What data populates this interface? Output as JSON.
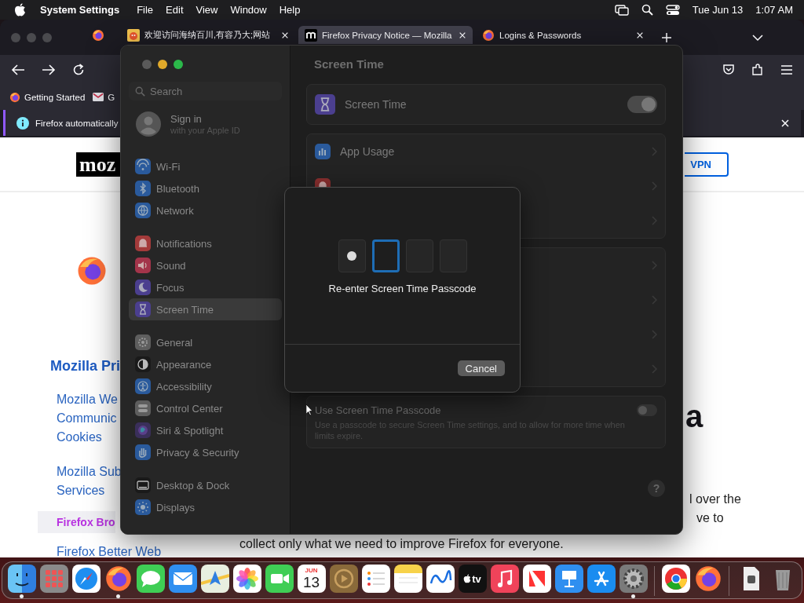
{
  "menubar": {
    "app_name": "System Settings",
    "menus": [
      "File",
      "Edit",
      "View",
      "Window",
      "Help"
    ],
    "date": "Tue Jun 13",
    "time": "1:07 AM"
  },
  "browser": {
    "tabs": [
      {
        "kind": "pinned",
        "selected": false
      },
      {
        "kind": "cartoon",
        "title": "欢迎访问海纳百川,有容乃大;网站",
        "selected": false
      },
      {
        "kind": "tile",
        "title": "Firefox Privacy Notice — Mozilla",
        "selected": true
      },
      {
        "kind": "fox",
        "title": "Logins & Passwords",
        "selected": false
      }
    ],
    "bookmarks": [
      {
        "label": "Getting Started",
        "kind": "fox"
      },
      {
        "label": "G",
        "kind": "envelope"
      }
    ],
    "notification": "Firefox automatically",
    "page": {
      "logo_text": "moz",
      "vpn_button": "VPN",
      "nav_heading": "Mozilla Pri",
      "nav_items": [
        {
          "lines": [
            "Mozilla We",
            "Communic",
            "Cookies"
          ],
          "selected": false
        },
        {
          "lines": [
            "Mozilla Sub",
            "Services"
          ],
          "selected": false
        },
        {
          "lines": [
            "Firefox Bro"
          ],
          "selected": true
        },
        {
          "lines": [
            "Firefox Better Web"
          ],
          "selected": false
        }
      ],
      "heading_fragment": "a",
      "body_lines": [
        "l over the",
        "ve to",
        "collect only what we need to improve Firefox for everyone."
      ]
    }
  },
  "settings": {
    "search": {
      "placeholder": "Search"
    },
    "account": {
      "title": "Sign in",
      "subtitle": "with your Apple ID"
    },
    "sidebar_groups": [
      {
        "items": [
          {
            "label": "Wi-Fi",
            "kind": "wifi",
            "color": "#2a5a9c",
            "selected": false
          },
          {
            "label": "Bluetooth",
            "kind": "bluetooth",
            "color": "#2a5a9c",
            "selected": false
          },
          {
            "label": "Network",
            "kind": "globe",
            "color": "#2a5a9c",
            "selected": false
          }
        ]
      },
      {
        "items": [
          {
            "label": "Notifications",
            "kind": "bell",
            "color": "#a33a3a",
            "selected": false
          },
          {
            "label": "Sound",
            "kind": "speaker",
            "color": "#a3344a",
            "selected": false
          },
          {
            "label": "Focus",
            "kind": "moon",
            "color": "#4b3f8f",
            "selected": false
          },
          {
            "label": "Screen Time",
            "kind": "hourglass",
            "color": "#4b3f8f",
            "selected": true
          }
        ]
      },
      {
        "items": [
          {
            "label": "General",
            "kind": "gear",
            "color": "#5e5e5e",
            "selected": false
          },
          {
            "label": "Appearance",
            "kind": "contrast",
            "color": "#1a1a1a",
            "selected": false
          },
          {
            "label": "Accessibility",
            "kind": "person",
            "color": "#2a5a9c",
            "selected": false
          },
          {
            "label": "Control Center",
            "kind": "toggles",
            "color": "#5e5e5e",
            "selected": false
          },
          {
            "label": "Siri & Spotlight",
            "kind": "orb",
            "color": "#3a2f5a",
            "selected": false
          },
          {
            "label": "Privacy & Security",
            "kind": "hand",
            "color": "#2a5a9c",
            "selected": false
          }
        ]
      },
      {
        "items": [
          {
            "label": "Desktop & Dock",
            "kind": "dock",
            "color": "#1a1a1a",
            "selected": false
          },
          {
            "label": "Displays",
            "kind": "sun",
            "color": "#2a5a9c",
            "selected": false
          }
        ]
      }
    ],
    "title": "Screen Time",
    "main_toggle": {
      "label": "Screen Time",
      "on": true
    },
    "usage_rows": [
      {
        "kind": "chart",
        "label": "App Usage"
      },
      {
        "kind": "bell"
      },
      {
        "kind": "hidden"
      }
    ],
    "limit_rows": [
      {
        "kind": "hidden"
      },
      {
        "kind": "hidden"
      },
      {
        "kind": "hidden"
      },
      {
        "kind": "hidden"
      }
    ],
    "passcode_setting": {
      "label": "Use Screen Time Passcode",
      "description": "Use a passcode to secure Screen Time settings, and to allow for more time when limits expire.",
      "on": false
    },
    "help_button": "?",
    "sheet": {
      "digits": [
        {
          "filled": true,
          "focused": false
        },
        {
          "filled": false,
          "focused": true
        },
        {
          "filled": false,
          "focused": false
        },
        {
          "filled": false,
          "focused": false
        }
      ],
      "prompt": "Re-enter Screen Time Passcode",
      "cancel": "Cancel"
    }
  },
  "dock": {
    "items": [
      {
        "kind": "finder",
        "running": true
      },
      {
        "kind": "launchpad",
        "running": false
      },
      {
        "kind": "safari",
        "running": false
      },
      {
        "kind": "firefox",
        "running": true
      },
      {
        "kind": "messages",
        "running": false
      },
      {
        "kind": "mail",
        "running": false
      },
      {
        "kind": "maps",
        "running": false
      },
      {
        "kind": "photos",
        "running": false
      },
      {
        "kind": "facetime",
        "running": false
      },
      {
        "kind": "calendar",
        "month": "JUN",
        "day": "13",
        "running": false
      },
      {
        "kind": "player",
        "running": false
      },
      {
        "kind": "reminders",
        "running": false
      },
      {
        "kind": "notes",
        "running": false
      },
      {
        "kind": "freeform",
        "running": false
      },
      {
        "kind": "tv",
        "text": "tv",
        "running": false
      },
      {
        "kind": "music",
        "running": false
      },
      {
        "kind": "news",
        "running": false
      },
      {
        "kind": "keynote",
        "running": false
      },
      {
        "kind": "store",
        "running": false
      },
      {
        "kind": "settings",
        "running": true
      },
      {
        "kind": "separator"
      },
      {
        "kind": "chrome",
        "running": false
      },
      {
        "kind": "firefox",
        "running": false
      },
      {
        "kind": "separator"
      },
      {
        "kind": "document",
        "running": false
      },
      {
        "kind": "trash",
        "running": false
      }
    ]
  }
}
